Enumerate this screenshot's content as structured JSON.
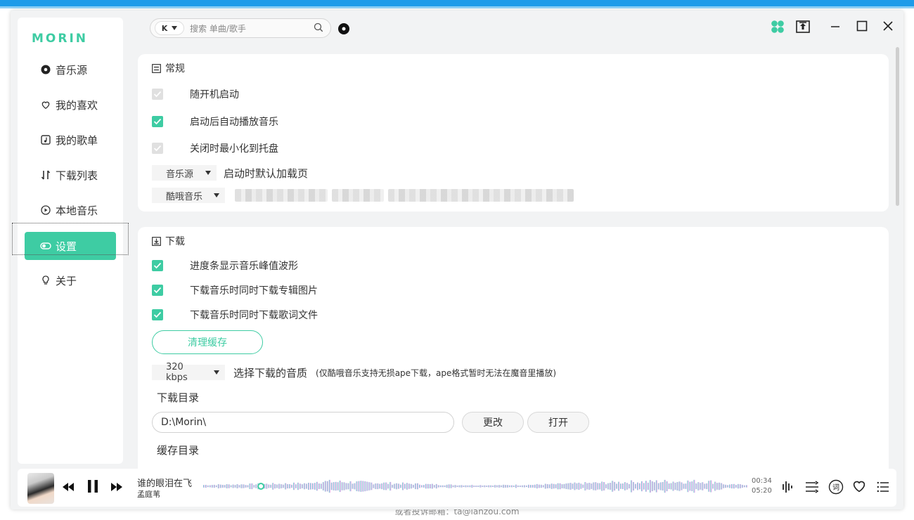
{
  "app": {
    "logo_text": "MORIN",
    "footer_text": "或者投诉邮箱：ta@lanzou.com"
  },
  "sidebar": {
    "items": [
      {
        "label": "音乐源",
        "icon": "disc-icon"
      },
      {
        "label": "我的喜欢",
        "icon": "heart-icon"
      },
      {
        "label": "我的歌单",
        "icon": "playlist-icon"
      },
      {
        "label": "下载列表",
        "icon": "sort-arrows-icon"
      },
      {
        "label": "本地音乐",
        "icon": "play-circle-icon"
      },
      {
        "label": "设置",
        "icon": "toggle-icon",
        "active": true
      },
      {
        "label": "关于",
        "icon": "bulb-icon"
      }
    ]
  },
  "header": {
    "source_label": "K",
    "search_placeholder": "搜索 单曲/歌手"
  },
  "general": {
    "title": "常规",
    "options": [
      {
        "label": "随开机启动",
        "state": "disabled"
      },
      {
        "label": "启动后自动播放音乐",
        "state": "checked"
      },
      {
        "label": "关闭时最小化到托盘",
        "state": "disabled"
      }
    ],
    "startup_page_value": "音乐源",
    "startup_page_label": "启动时默认加载页",
    "source_value": "酷哦音乐"
  },
  "download": {
    "title": "下载",
    "options": [
      {
        "label": "进度条显示音乐峰值波形",
        "state": "checked"
      },
      {
        "label": "下载音乐时同时下载专辑图片",
        "state": "checked"
      },
      {
        "label": "下载音乐时同时下载歌词文件",
        "state": "checked"
      }
    ],
    "clear_cache_label": "清理缓存",
    "quality_value": "320 kbps",
    "quality_label": "选择下载的音质",
    "quality_note": "(仅酷哦音乐支持无损ape下载，ape格式暂时无法在魔音里播放)",
    "dir_label": "下载目录",
    "dir_value": "D:\\Morin\\",
    "change_label": "更改",
    "open_label": "打开",
    "cache_dir_label": "缓存目录"
  },
  "player": {
    "song_title": "谁的眼泪在飞",
    "artist": "孟庭苇",
    "current_time": "00:34",
    "total_time": "05:20",
    "progress": 0.106
  },
  "colors": {
    "accent": "#3ecca3",
    "top_bar": "#1e9be9"
  }
}
